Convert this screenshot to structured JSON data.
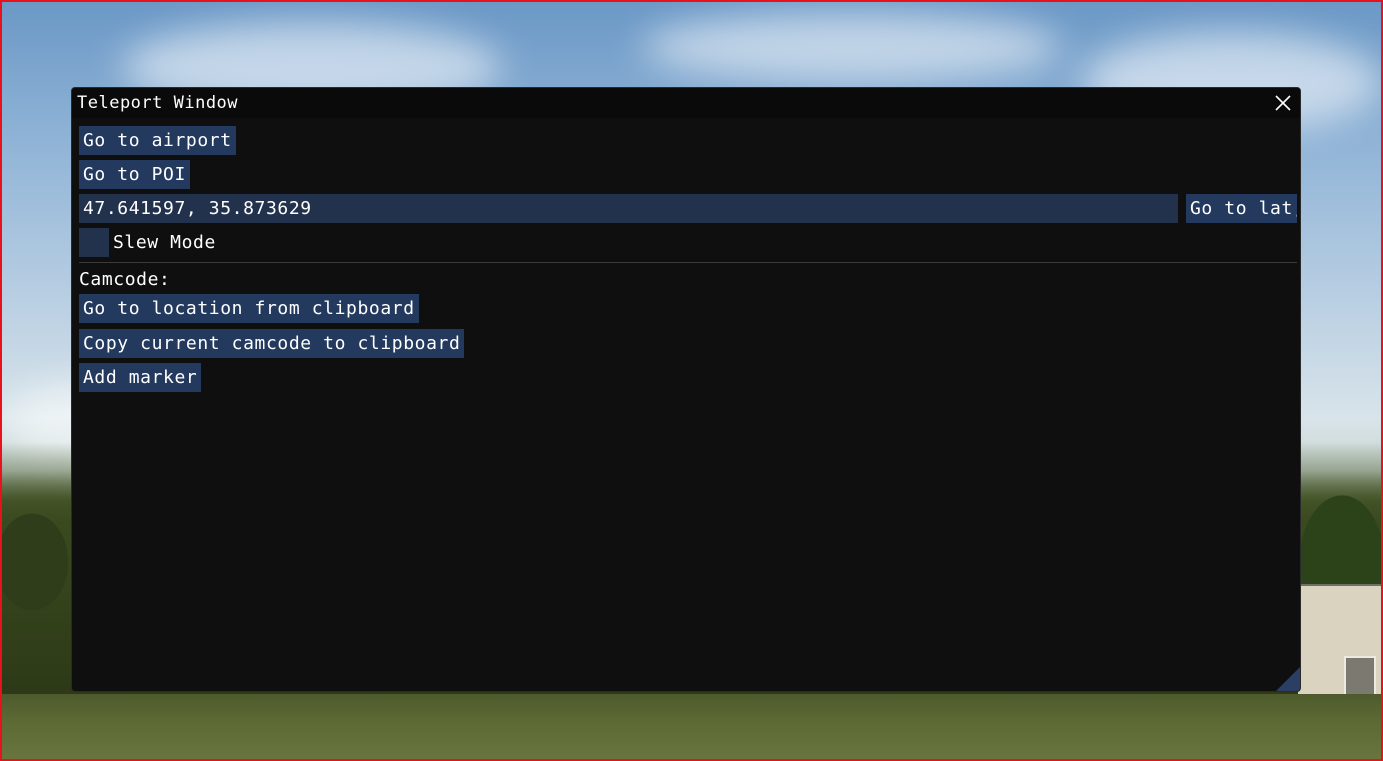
{
  "window": {
    "title": "Teleport Window"
  },
  "buttons": {
    "go_to_airport": "Go to airport",
    "go_to_poi": "Go to POI",
    "go_to_latlon": "Go to lat,",
    "go_to_location_clipboard": "Go to location from clipboard",
    "copy_camcode": "Copy current camcode to clipboard",
    "add_marker": "Add marker"
  },
  "coords": {
    "value": "47.641597, 35.873629"
  },
  "slew_mode": {
    "label": "Slew Mode",
    "checked": false
  },
  "camcode_section": {
    "label": "Camcode:"
  },
  "icons": {
    "close": "close-icon"
  },
  "colors": {
    "window_bg": "#0f0f0f",
    "button_bg": "#233a5e",
    "input_bg": "#22324d",
    "frame_border": "#e8121c"
  }
}
